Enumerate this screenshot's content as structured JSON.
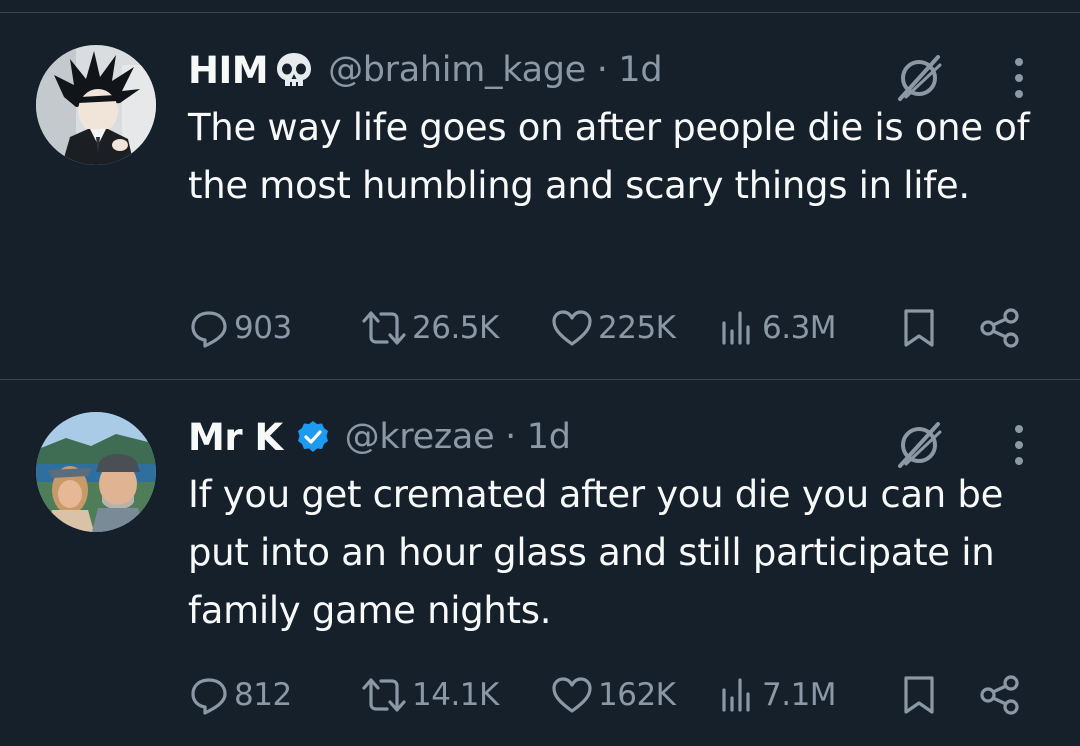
{
  "theme": {
    "background": "#15202b",
    "text": "#f7f9f9",
    "secondary": "#8b98a5",
    "divider": "#38444d",
    "verified": "#1d9bf0"
  },
  "tweets": [
    {
      "display_name": "HIM",
      "name_emoji": "skull-emoji",
      "verified": false,
      "handle_line": "@brahim_kage · 1d",
      "text": "The way life goes on after people die is one of the most humbling and scary things in life.",
      "replies": "903",
      "retweets": "26.5K",
      "likes": "225K",
      "views": "6.3M"
    },
    {
      "display_name": "Mr K",
      "verified": true,
      "handle_line": "@krezae · 1d",
      "text": "If you get cremated after you die you can be put into an hour glass and still participate in family game nights.",
      "replies": "812",
      "retweets": "14.1K",
      "likes": "162K",
      "views": "7.1M"
    }
  ],
  "icons": {
    "reply": "speech-bubble-icon",
    "retweet": "retweet-arrows-icon",
    "like": "heart-icon",
    "views": "bar-chart-icon",
    "bookmark": "bookmark-icon",
    "share": "share-nodes-icon",
    "grok": "slashed-circle-grok-icon",
    "more": "vertical-dots-icon"
  }
}
